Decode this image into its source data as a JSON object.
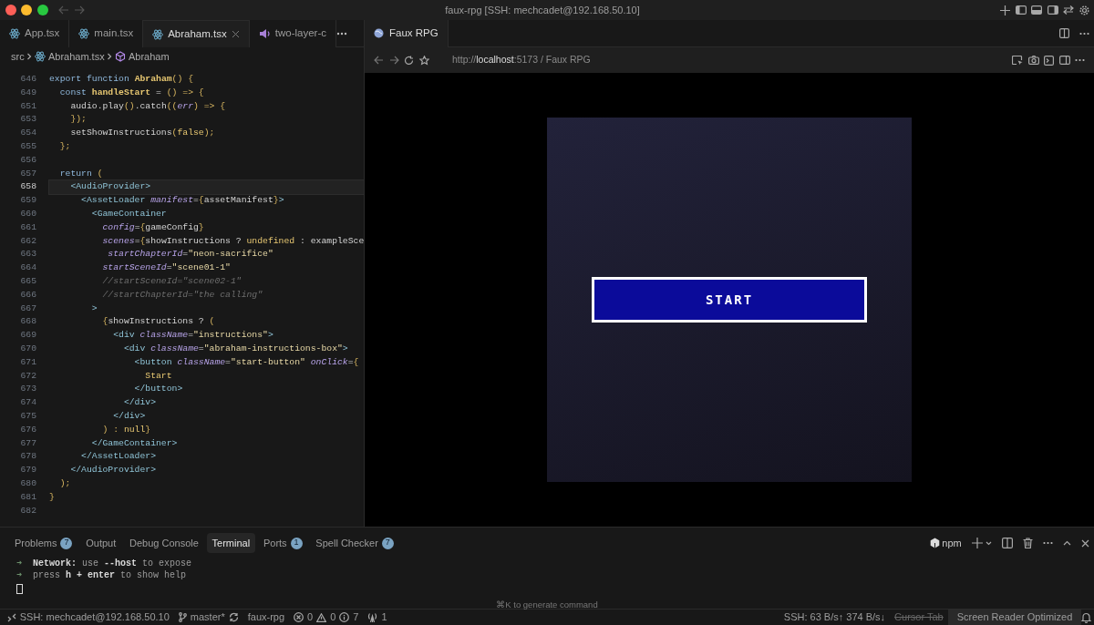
{
  "window": {
    "title": "faux-rpg [SSH: mechcadet@192.168.50.10]"
  },
  "editor": {
    "tabs": [
      {
        "label": "App.tsx",
        "kind": "react",
        "selected": false
      },
      {
        "label": "main.tsx",
        "kind": "react",
        "selected": false
      },
      {
        "label": "Abraham.tsx",
        "kind": "react",
        "selected": true
      },
      {
        "label": "two-layer-c",
        "kind": "audio",
        "selected": false
      }
    ],
    "breadcrumbs": [
      {
        "label": "src",
        "kind": "folder"
      },
      {
        "label": "Abraham.tsx",
        "kind": "react"
      },
      {
        "label": "Abraham",
        "kind": "symbol"
      }
    ],
    "lines": [
      {
        "num": "646",
        "current": false,
        "tokens": [
          {
            "kind": "k",
            "text": "export function "
          },
          {
            "kind": "f",
            "text": "Abraham"
          },
          {
            "kind": "u",
            "text": "() {"
          }
        ]
      },
      {
        "num": "649",
        "current": false,
        "tokens": [
          {
            "kind": "k",
            "text": "  const "
          },
          {
            "kind": "f",
            "text": "handleStart"
          },
          {
            "kind": "p",
            "text": " = "
          },
          {
            "kind": "u",
            "text": "() => {"
          }
        ]
      },
      {
        "num": "651",
        "current": false,
        "tokens": [
          {
            "kind": "p",
            "text": "    audio.play"
          },
          {
            "kind": "u",
            "text": "()"
          },
          {
            "kind": "p",
            "text": ".catch"
          },
          {
            "kind": "u",
            "text": "(("
          },
          {
            "kind": "a",
            "text": "err"
          },
          {
            "kind": "u",
            "text": ") => {"
          }
        ]
      },
      {
        "num": "653",
        "current": false,
        "tokens": [
          {
            "kind": "u",
            "text": "    });"
          }
        ]
      },
      {
        "num": "654",
        "current": false,
        "tokens": [
          {
            "kind": "p",
            "text": "    setShowInstructions"
          },
          {
            "kind": "u",
            "text": "("
          },
          {
            "kind": "y",
            "text": "false"
          },
          {
            "kind": "u",
            "text": ");"
          }
        ]
      },
      {
        "num": "655",
        "current": false,
        "tokens": [
          {
            "kind": "u",
            "text": "  };"
          }
        ]
      },
      {
        "num": "656",
        "current": false
      },
      {
        "num": "657",
        "current": false,
        "tokens": [
          {
            "kind": "k",
            "text": "  return "
          },
          {
            "kind": "u",
            "text": "("
          }
        ]
      },
      {
        "num": "658",
        "current": true,
        "tokens": [
          {
            "kind": "t",
            "text": "    <AudioProvider>"
          }
        ]
      },
      {
        "num": "659",
        "current": false,
        "tokens": [
          {
            "kind": "t",
            "text": "      <AssetLoader "
          },
          {
            "kind": "a",
            "text": "manifest"
          },
          {
            "kind": "p",
            "text": "="
          },
          {
            "kind": "u",
            "text": "{"
          },
          {
            "kind": "p",
            "text": "assetManifest"
          },
          {
            "kind": "u",
            "text": "}"
          },
          {
            "kind": "t",
            "text": ">"
          }
        ]
      },
      {
        "num": "660",
        "current": false,
        "tokens": [
          {
            "kind": "t",
            "text": "        <GameContainer"
          }
        ]
      },
      {
        "num": "661",
        "current": false,
        "tokens": [
          {
            "kind": "a",
            "text": "          config"
          },
          {
            "kind": "p",
            "text": "="
          },
          {
            "kind": "u",
            "text": "{"
          },
          {
            "kind": "p",
            "text": "gameConfig"
          },
          {
            "kind": "u",
            "text": "}"
          }
        ]
      },
      {
        "num": "662",
        "current": false,
        "tokens": [
          {
            "kind": "a",
            "text": "          scenes"
          },
          {
            "kind": "p",
            "text": "="
          },
          {
            "kind": "u",
            "text": "{"
          },
          {
            "kind": "p",
            "text": "showInstructions ? "
          },
          {
            "kind": "y",
            "text": "undefined"
          },
          {
            "kind": "p",
            "text": " : exampleSce"
          }
        ]
      },
      {
        "num": "663",
        "current": false,
        "tokens": [
          {
            "kind": "a",
            "text": "           startChapterId"
          },
          {
            "kind": "p",
            "text": "="
          },
          {
            "kind": "s",
            "text": "\"neon-sacrifice\""
          }
        ]
      },
      {
        "num": "664",
        "current": false,
        "tokens": [
          {
            "kind": "a",
            "text": "          startSceneId"
          },
          {
            "kind": "p",
            "text": "="
          },
          {
            "kind": "s",
            "text": "\"scene01-1\""
          }
        ]
      },
      {
        "num": "665",
        "current": false,
        "tokens": [
          {
            "kind": "c",
            "text": "          //startSceneId=\"scene02-1\""
          }
        ]
      },
      {
        "num": "666",
        "current": false,
        "tokens": [
          {
            "kind": "c",
            "text": "          //startChapterId=\"the calling\""
          }
        ]
      },
      {
        "num": "667",
        "current": false,
        "tokens": [
          {
            "kind": "t",
            "text": "        >"
          }
        ]
      },
      {
        "num": "668",
        "current": false,
        "tokens": [
          {
            "kind": "u",
            "text": "          {"
          },
          {
            "kind": "p",
            "text": "showInstructions ? "
          },
          {
            "kind": "u",
            "text": "("
          }
        ]
      },
      {
        "num": "669",
        "current": false,
        "tokens": [
          {
            "kind": "t",
            "text": "            <div "
          },
          {
            "kind": "a",
            "text": "className"
          },
          {
            "kind": "p",
            "text": "="
          },
          {
            "kind": "s",
            "text": "\"instructions\""
          },
          {
            "kind": "t",
            "text": ">"
          }
        ]
      },
      {
        "num": "670",
        "current": false,
        "tokens": [
          {
            "kind": "t",
            "text": "              <div "
          },
          {
            "kind": "a",
            "text": "className"
          },
          {
            "kind": "p",
            "text": "="
          },
          {
            "kind": "s",
            "text": "\"abraham-instructions-box\""
          },
          {
            "kind": "t",
            "text": ">"
          }
        ]
      },
      {
        "num": "671",
        "current": false,
        "tokens": [
          {
            "kind": "t",
            "text": "                <button "
          },
          {
            "kind": "a",
            "text": "className"
          },
          {
            "kind": "p",
            "text": "="
          },
          {
            "kind": "s",
            "text": "\"start-button\""
          },
          {
            "kind": "a",
            "text": " onClick"
          },
          {
            "kind": "p",
            "text": "="
          },
          {
            "kind": "u",
            "text": "{"
          }
        ]
      },
      {
        "num": "672",
        "current": false,
        "tokens": [
          {
            "kind": "y",
            "text": "                  Start"
          }
        ]
      },
      {
        "num": "673",
        "current": false,
        "tokens": [
          {
            "kind": "t",
            "text": "                </button>"
          }
        ]
      },
      {
        "num": "674",
        "current": false,
        "tokens": [
          {
            "kind": "t",
            "text": "              </div>"
          }
        ]
      },
      {
        "num": "675",
        "current": false,
        "tokens": [
          {
            "kind": "t",
            "text": "            </div>"
          }
        ]
      },
      {
        "num": "676",
        "current": false,
        "tokens": [
          {
            "kind": "u",
            "text": "          ) : "
          },
          {
            "kind": "y",
            "text": "null"
          },
          {
            "kind": "u",
            "text": "}"
          }
        ]
      },
      {
        "num": "677",
        "current": false,
        "tokens": [
          {
            "kind": "t",
            "text": "        </GameContainer>"
          }
        ]
      },
      {
        "num": "678",
        "current": false,
        "tokens": [
          {
            "kind": "t",
            "text": "      </AssetLoader>"
          }
        ]
      },
      {
        "num": "679",
        "current": false,
        "tokens": [
          {
            "kind": "t",
            "text": "    </AudioProvider>"
          }
        ]
      },
      {
        "num": "680",
        "current": false,
        "tokens": [
          {
            "kind": "u",
            "text": "  );"
          }
        ]
      },
      {
        "num": "681",
        "current": false,
        "tokens": [
          {
            "kind": "u",
            "text": "}"
          }
        ]
      },
      {
        "num": "682",
        "current": false
      }
    ]
  },
  "browser": {
    "tab": {
      "label": "Faux RPG",
      "selected": true
    },
    "url": {
      "scheme": "http://",
      "host": "localhost",
      "rest": ":5173 / Faux RPG"
    },
    "game": {
      "button": "START"
    }
  },
  "panel": {
    "tabs": [
      {
        "label": "Problems",
        "badge": "7",
        "selected": false
      },
      {
        "label": "Output",
        "selected": false
      },
      {
        "label": "Debug Console",
        "selected": false
      },
      {
        "label": "Terminal",
        "selected": true
      },
      {
        "label": "Ports",
        "badge": "1",
        "selected": false
      },
      {
        "label": "Spell Checker",
        "badge": "7",
        "selected": false
      }
    ],
    "profile": "npm",
    "terminal_lines": [
      {
        "arrow": "➜",
        "text": "**Network:** use **--host** to expose"
      },
      {
        "arrow": "➜",
        "text": "press **h + enter** to show help"
      }
    ],
    "hint": "⌘K to generate command"
  },
  "status_bar": {
    "remote": "SSH: mechcadet@192.168.50.10",
    "branch": "master*",
    "project": "faux-rpg",
    "errors": "0",
    "warnings": "0",
    "infos": "7",
    "ports": "1",
    "traffic": "SSH: 63 B/s↑ 374 B/s↓",
    "cursor_tab": {
      "label": "Cursor Tab",
      "disabled": true
    },
    "screen_reader": "Screen Reader Optimized"
  }
}
